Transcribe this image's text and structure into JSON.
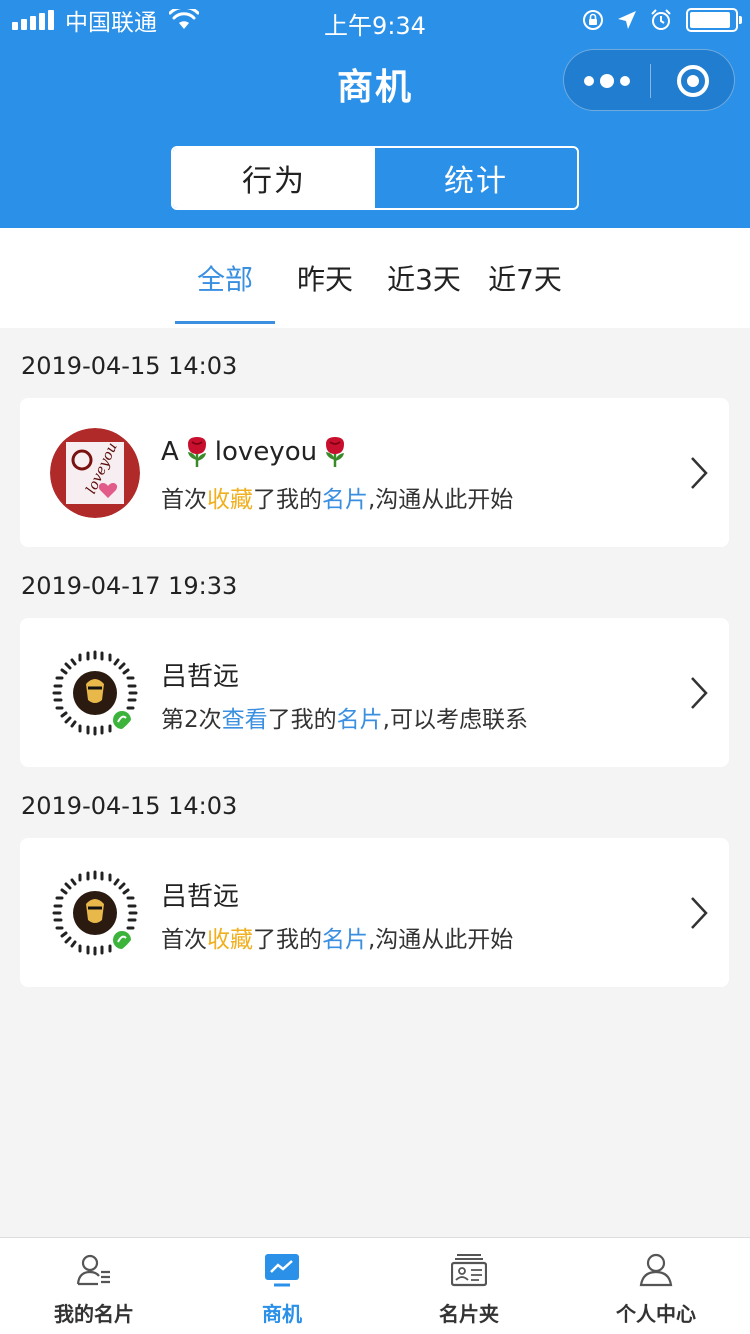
{
  "status_bar": {
    "carrier": "中国联通",
    "time": "上午9:34",
    "battery_level": 0.9
  },
  "nav": {
    "title": "商机"
  },
  "segment": {
    "options": [
      "行为",
      "统计"
    ],
    "selected": "行为"
  },
  "filters": {
    "tabs": [
      "全部",
      "昨天",
      "近3天",
      "近7天"
    ],
    "selected": "全部"
  },
  "records": [
    {
      "date": "2019-04-15 14:03",
      "name_prefix": "A",
      "name_suffix": "loveyou",
      "avatar_icon": "loveyou-avatar",
      "desc": {
        "pre": "首次",
        "action": "收藏",
        "mid": "了我的",
        "obj": "名片",
        "post": ",沟通从此开始"
      }
    },
    {
      "date": "2019-04-17 19:33",
      "name": "吕哲远",
      "avatar_icon": "qr-code-avatar",
      "desc": {
        "pre": "第2次",
        "action": "查看",
        "mid": "了我的",
        "obj": "名片",
        "post": ",可以考虑联系"
      }
    },
    {
      "date": "2019-04-15 14:03",
      "name": "吕哲远",
      "avatar_icon": "qr-code-avatar",
      "desc": {
        "pre": "首次",
        "action": "收藏",
        "mid": "了我的",
        "obj": "名片",
        "post": ",沟通从此开始"
      }
    }
  ],
  "tabbar": {
    "items": [
      {
        "label": "我的名片",
        "icon": "user-card-icon"
      },
      {
        "label": "商机",
        "icon": "chart-icon"
      },
      {
        "label": "名片夹",
        "icon": "card-holder-icon"
      },
      {
        "label": "个人中心",
        "icon": "person-icon"
      }
    ],
    "active": "商机"
  },
  "colors": {
    "header_blue": "#2b90e8",
    "accent_blue": "#3a8fe0",
    "highlight_yellow": "#f0b020",
    "background": "#f4f4f4"
  }
}
